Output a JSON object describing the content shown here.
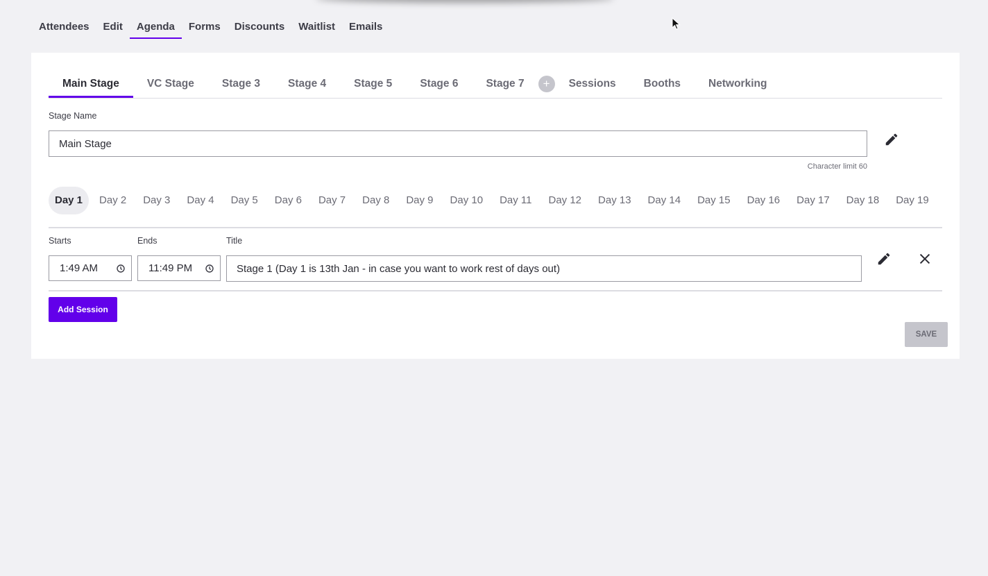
{
  "top_nav": {
    "items": [
      {
        "label": "Attendees",
        "active": false
      },
      {
        "label": "Edit",
        "active": false
      },
      {
        "label": "Agenda",
        "active": true
      },
      {
        "label": "Forms",
        "active": false
      },
      {
        "label": "Discounts",
        "active": false
      },
      {
        "label": "Waitlist",
        "active": false
      },
      {
        "label": "Emails",
        "active": false
      }
    ]
  },
  "stage_tabs": {
    "stages": [
      "Main Stage",
      "VC Stage",
      "Stage 3",
      "Stage 4",
      "Stage 5",
      "Stage 6",
      "Stage 7"
    ],
    "add_icon": "plus-icon",
    "add_glyph": "+",
    "extras": [
      "Sessions",
      "Booths",
      "Networking"
    ],
    "active": "Main Stage"
  },
  "stage_name": {
    "label": "Stage Name",
    "value": "Main Stage",
    "hint": "Character limit 60"
  },
  "days": {
    "items": [
      "Day 1",
      "Day 2",
      "Day 3",
      "Day 4",
      "Day 5",
      "Day 6",
      "Day 7",
      "Day 8",
      "Day 9",
      "Day 10",
      "Day 11",
      "Day 12",
      "Day 13",
      "Day 14",
      "Day 15",
      "Day 16",
      "Day 17",
      "Day 18",
      "Day 19"
    ],
    "active": "Day 1"
  },
  "session": {
    "starts_label": "Starts",
    "ends_label": "Ends",
    "title_label": "Title",
    "starts": "1:49 AM",
    "ends": "11:49 PM",
    "title": "Stage 1 (Day 1 is 13th Jan - in case you want to work rest of days out)"
  },
  "buttons": {
    "add_session": "Add Session",
    "save": "SAVE"
  },
  "colors": {
    "accent": "#6200ea",
    "background": "#f1f1f4",
    "disabled": "#c5c5cc"
  }
}
